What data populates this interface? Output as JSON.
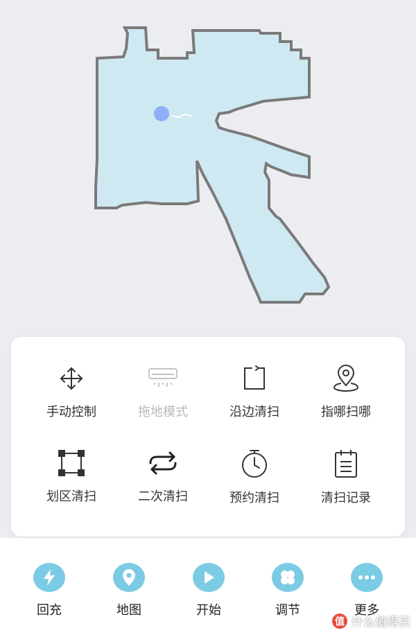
{
  "map": {
    "floor_color": "#cfe9f3",
    "wall_color": "#7a7a7a",
    "robot_color": "#8fb0f5"
  },
  "panel": {
    "row1": [
      {
        "label": "手动控制",
        "icon": "move-arrows-icon",
        "enabled": true
      },
      {
        "label": "拖地模式",
        "icon": "mop-mode-icon",
        "enabled": false
      },
      {
        "label": "沿边清扫",
        "icon": "edge-clean-icon",
        "enabled": true
      },
      {
        "label": "指哪扫哪",
        "icon": "location-pin-icon",
        "enabled": true
      }
    ],
    "row2": [
      {
        "label": "划区清扫",
        "icon": "zone-square-icon",
        "enabled": true
      },
      {
        "label": "二次清扫",
        "icon": "repeat-icon",
        "enabled": true
      },
      {
        "label": "预约清扫",
        "icon": "timer-icon",
        "enabled": true
      },
      {
        "label": "清扫记录",
        "icon": "clipboard-icon",
        "enabled": true
      }
    ]
  },
  "nav": {
    "items": [
      {
        "label": "回充",
        "icon": "lightning-icon"
      },
      {
        "label": "地图",
        "icon": "map-pin-icon"
      },
      {
        "label": "开始",
        "icon": "play-icon"
      },
      {
        "label": "调节",
        "icon": "clover-icon"
      },
      {
        "label": "更多",
        "icon": "more-dots-icon"
      }
    ],
    "accent": "#7ccbe5"
  },
  "watermark": {
    "text": "什么值得买",
    "badge": "值"
  }
}
